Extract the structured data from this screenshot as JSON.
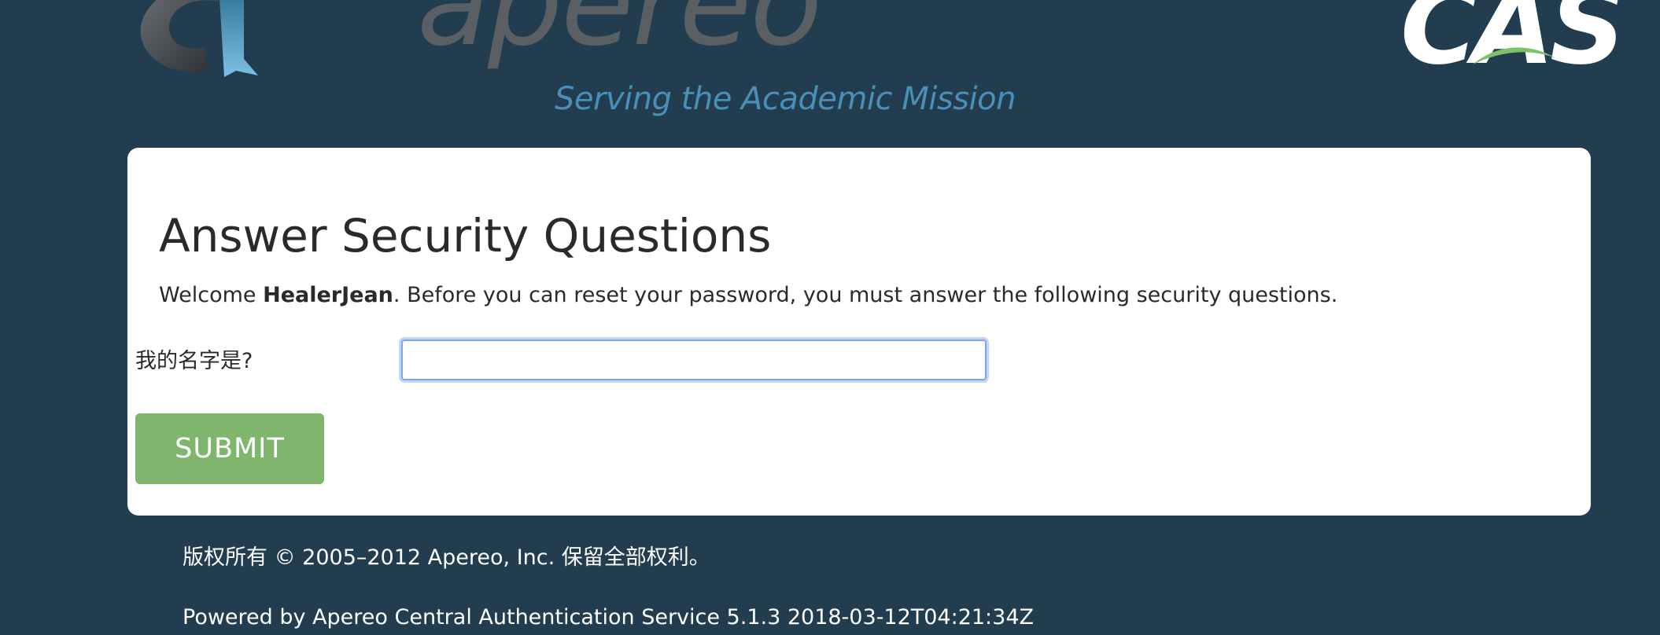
{
  "header": {
    "apereo_logo": {
      "wordmark": "apereo",
      "tagline": "Serving the Academic Mission"
    },
    "cas_logo": {
      "text": "CAS"
    }
  },
  "form": {
    "title": "Answer Security Questions",
    "intro": {
      "prefix": "Welcome ",
      "username": "HealerJean",
      "suffix": ". Before you can reset your password, you must answer the following security questions."
    },
    "question_label": "我的名字是?",
    "answer_value": "",
    "submit_label": "SUBMIT"
  },
  "footer": {
    "copyright": "版权所有 © 2005–2012 Apereo, Inc. 保留全部权利。",
    "powered_by": "Powered by Apereo Central Authentication Service 5.1.3 2018-03-12T04:21:34Z"
  },
  "colors": {
    "background": "#223d50",
    "panel": "#ffffff",
    "submit_button": "#80b56e",
    "input_focus": "#7aa7e9"
  }
}
